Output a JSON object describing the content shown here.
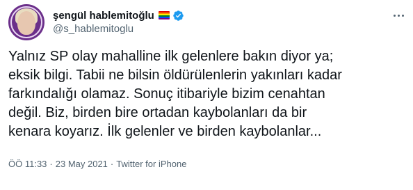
{
  "author": {
    "display_name": "şengül hablemitoğlu",
    "handle": "@s_hablemitoglu",
    "verified": true,
    "flag_colors": [
      "#e40303",
      "#ff8c00",
      "#ffed00",
      "#008026",
      "#004dff",
      "#750787"
    ]
  },
  "tweet": {
    "text": "Yalnız SP olay mahalline ilk gelenlere bakın diyor ya;\neksik bilgi. Tabii ne bilsin öldürülenlerin yakınları kadar\nfarkındalığı olamaz. Sonuç itibariyle bizim cenahtan\ndeğil. Biz, birden bire ortadan kaybolanları da bir\nkenara koyarız. İlk gelenler ve birden kaybolanlar..."
  },
  "meta": {
    "time": "ÖÖ 11:33",
    "separator": "·",
    "date": "23 May 2021",
    "source": "Twitter for iPhone"
  },
  "icons": {
    "more": "more-icon",
    "verified": "verified-badge-icon"
  },
  "colors": {
    "verified_blue": "#1d9bf0",
    "secondary_text": "#536471"
  }
}
